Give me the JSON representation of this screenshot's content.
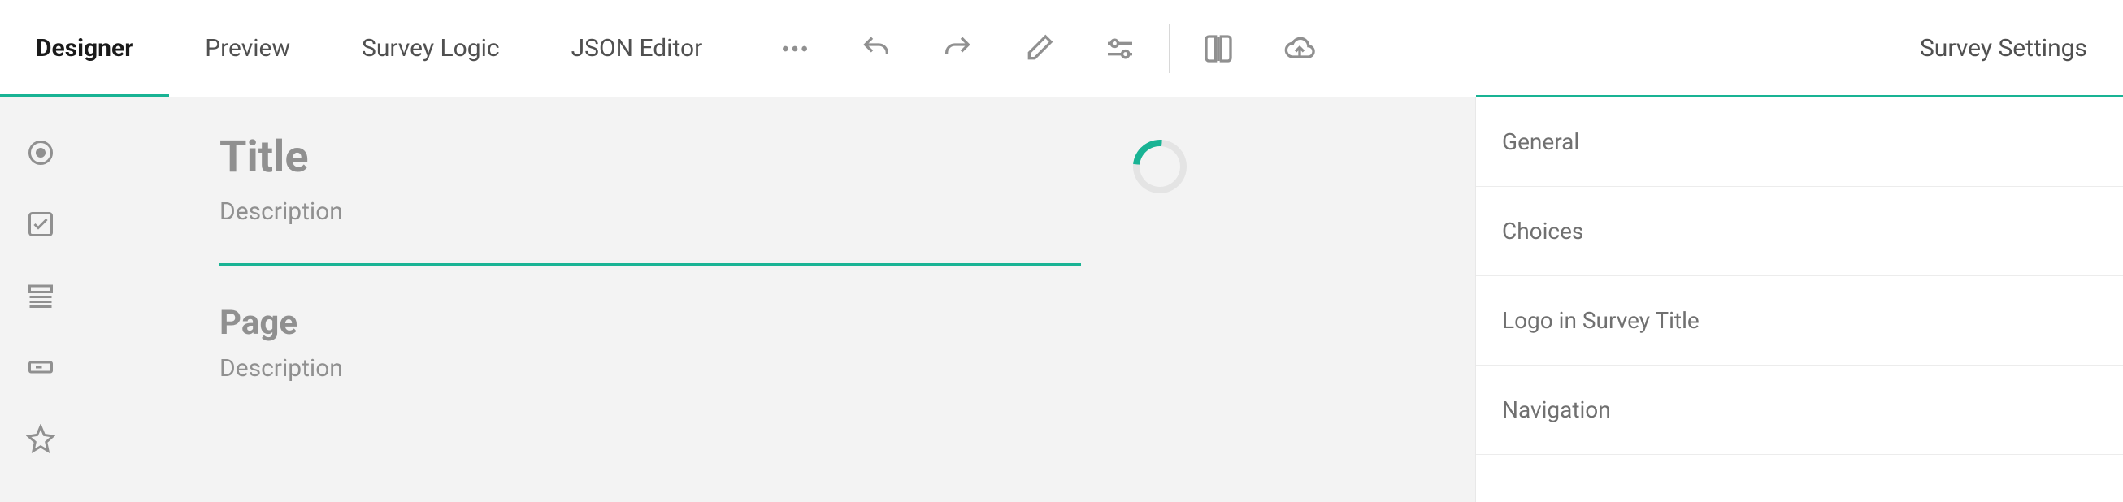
{
  "tabs": {
    "designer": "Designer",
    "preview": "Preview",
    "logic": "Survey Logic",
    "json": "JSON Editor"
  },
  "survey": {
    "title_placeholder": "Title",
    "desc_placeholder": "Description"
  },
  "page": {
    "title_placeholder": "Page",
    "desc_placeholder": "Description"
  },
  "right_panel": {
    "header": "Survey Settings",
    "sections": {
      "general": "General",
      "choices": "Choices",
      "logo": "Logo in Survey Title",
      "navigation": "Navigation"
    }
  }
}
